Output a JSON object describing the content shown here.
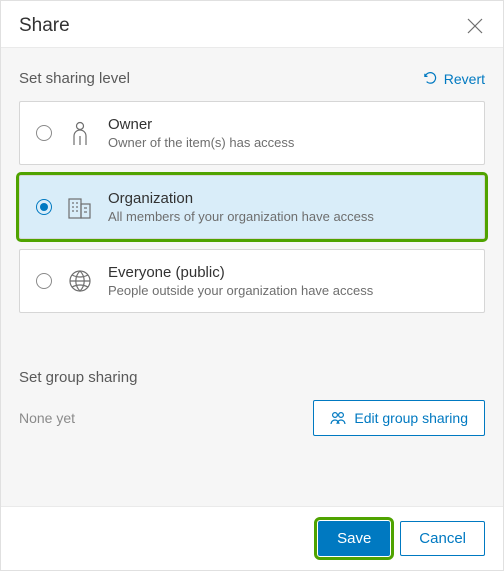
{
  "header": {
    "title": "Share"
  },
  "sharing": {
    "section_title": "Set sharing level",
    "revert_label": "Revert",
    "options": [
      {
        "title": "Owner",
        "desc": "Owner of the item(s) has access",
        "selected": false
      },
      {
        "title": "Organization",
        "desc": "All members of your organization have access",
        "selected": true
      },
      {
        "title": "Everyone (public)",
        "desc": "People outside your organization have access",
        "selected": false
      }
    ]
  },
  "groups": {
    "section_title": "Set group sharing",
    "status_text": "None yet",
    "edit_label": "Edit group sharing"
  },
  "footer": {
    "save_label": "Save",
    "cancel_label": "Cancel"
  }
}
